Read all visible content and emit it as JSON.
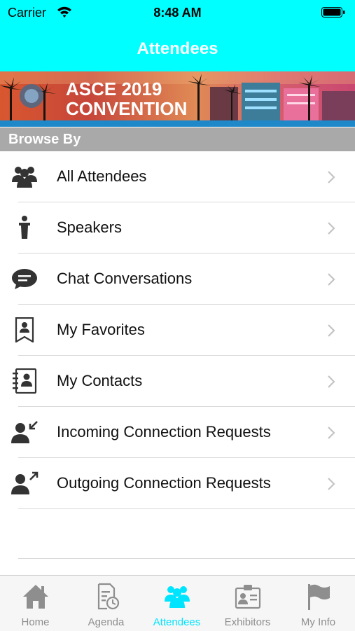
{
  "status_bar": {
    "carrier": "Carrier",
    "time": "8:48 AM"
  },
  "nav": {
    "title": "Attendees"
  },
  "banner": {
    "line1": "ASCE 2019",
    "line2": "CONVENTION"
  },
  "section": {
    "header": "Browse By"
  },
  "list": [
    {
      "label": "All Attendees",
      "icon": "group-icon"
    },
    {
      "label": "Speakers",
      "icon": "podium-speaker-icon"
    },
    {
      "label": "Chat Conversations",
      "icon": "chat-bubble-icon"
    },
    {
      "label": "My Favorites",
      "icon": "bookmark-person-icon"
    },
    {
      "label": "My Contacts",
      "icon": "address-book-icon"
    },
    {
      "label": "Incoming Connection Requests",
      "icon": "person-incoming-arrow-icon"
    },
    {
      "label": "Outgoing Connection Requests",
      "icon": "person-outgoing-arrow-icon"
    }
  ],
  "tabs": [
    {
      "label": "Home",
      "icon": "home-icon",
      "active": false
    },
    {
      "label": "Agenda",
      "icon": "agenda-clock-icon",
      "active": false
    },
    {
      "label": "Attendees",
      "icon": "attendees-group-icon",
      "active": true
    },
    {
      "label": "Exhibitors",
      "icon": "exhibitors-badge-icon",
      "active": false
    },
    {
      "label": "My Info",
      "icon": "flag-icon",
      "active": false
    }
  ],
  "colors": {
    "accent": "#00ffff",
    "active_tab": "#00e5ff",
    "section_header": "#a9a9a9",
    "icon": "#333333",
    "inactive_tab": "#8e8e8e"
  }
}
